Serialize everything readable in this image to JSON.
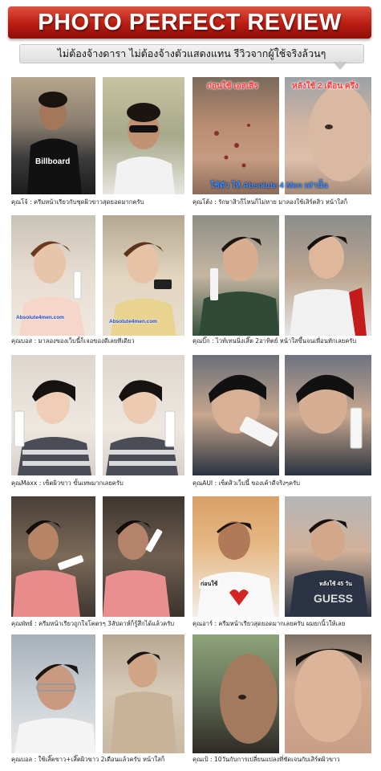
{
  "banner": {
    "title": "PHOTO PERFECT REVIEW"
  },
  "subtitle": "ไม่ต้องจ้างดารา ไม่ต้องจ้างตัวแสดงแทน รีวิวจากผู้ใช้จริงล้วนๆ",
  "overlays": {
    "before_label": "ก่อนใช้ เอสเสิร",
    "after_label": "หลังใช้ 2 เดือน ครึ่ง",
    "claim_label": "ใช้ตัว ให้ Absolute 4 Men เท่านั้น",
    "url_left": "Absolute4men.com",
    "url_right": "Absolute4men.com",
    "before_small": "ก่อนใช้",
    "after_small": "หลังใช้ 45 วัน"
  },
  "captions": [
    "คุณโจ้ : ครีมหน้าเรียวกับชุดผิวขาวสุดยอดมากครับ",
    "คุณโต้ง : รักษาสิวก็ไหนก็ไม่หาย มาลองใช้เสิร์ตสิว หน้าใสก็",
    "คุณบอส : มาลองของเว็บนี้ก็เจอของดีเลยทีเดียว",
    "คุณบิ๊ก : ไวท์เทนนิ่งเสิ๊ต 2อาทิตย์ หน้าใสขึ้นจนเพื่อนทักเลยครับ",
    "คุณMaxx : เซ็ตผิวขาว ขั้นเทพมากเลยครับ",
    "คุณAUI : เซ็ตสิวเว็บนี้ ของเค้าดีจริงๆครับ",
    "คุณพัทธ์ : ครีมหน้าเรียวถูกใจโคตรๆ 3สัปดาห์ก็รู้สึกได้แล้วครับ",
    "คุณอาร์ : ครีมหน้าเรียวสุดยอดมากเลยครับ ผมยกนิ้วให้เลย",
    "คุณบอล : ใช้เสิ๊ตขาว+เสิ๊ตผิวขาว 2เดือนแล้วครับ หน้าใสก็",
    "คุณเป้ : 10วันกับการเปลี่ยนแปลงที่ชัดเจนกับเสิร์ตผิวขาว"
  ],
  "colors": {
    "banner_red": "#c0211a",
    "caption_text": "#222222",
    "before_red": "#ff3b3b",
    "after_blue": "#3b8bff"
  }
}
